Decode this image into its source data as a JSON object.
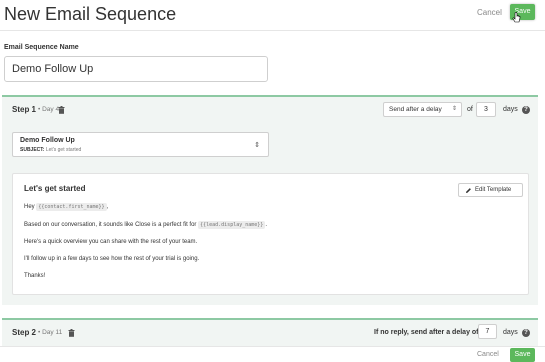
{
  "header": {
    "title": "New Email Sequence",
    "cancel_label": "Cancel",
    "save_label": "Save"
  },
  "sequence_name": {
    "label": "Email Sequence Name",
    "value": "Demo Follow Up"
  },
  "step1": {
    "title": "Step 1",
    "day": "• Day 4",
    "delay_option": "Send after a delay",
    "of_label": "of",
    "days_value": "3",
    "days_label": "days",
    "template": {
      "name": "Demo Follow Up",
      "subject_label": "SUBJECT:",
      "subject_value": "Let's get started"
    },
    "email": {
      "subject": "Let's get started",
      "edit_label": "Edit Template",
      "greeting": "Hey",
      "var_first_name": "{{contact.first_name}}",
      "comma": ",",
      "line2_prefix": "Based on our conversation, it sounds like Close is a perfect fit for",
      "var_lead_name": "{{lead.display_name}}",
      "period": ".",
      "line3": "Here's a quick overview you can share with the rest of your team.",
      "line4": "I'll follow up in a few days to see how the rest of your trial is going.",
      "line5": "Thanks!"
    }
  },
  "step2": {
    "title": "Step 2",
    "day": "• Day 11",
    "delay_label": "If no reply, send after a delay of",
    "days_value": "7",
    "days_label": "days"
  },
  "footer": {
    "cancel_label": "Cancel",
    "save_label": "Save"
  },
  "icons": {
    "trash": "trash-icon",
    "help": "help-icon",
    "pencil": "pencil-icon",
    "select_arrows": "chevron-updown-icon",
    "cursor": "hand-cursor-icon"
  },
  "colors": {
    "accent": "#5cb85c",
    "panel_border": "#8dc9a3",
    "panel_bg": "#f1f5f3"
  }
}
